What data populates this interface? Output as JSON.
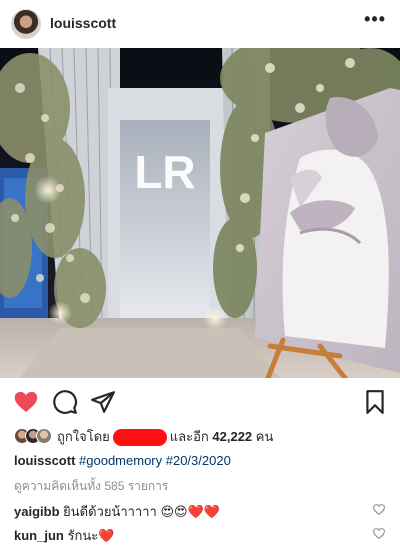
{
  "post": {
    "username": "louisscott",
    "more_label": "•••"
  },
  "likes": {
    "prefix": "ถูกใจโดย",
    "suffix": "และอีก",
    "count": "42,222",
    "unit": "คน"
  },
  "caption": {
    "username": "louisscott",
    "text": "#goodmemory  #20/3/2020"
  },
  "view_comments": "ดูความคิดเห็นทั้ง 585 รายการ",
  "comments": [
    {
      "username": "yaigibb",
      "text": "ยินดีด้วยน้าาาาา 😍😍❤️❤️"
    },
    {
      "username": "kun_jun",
      "text": "รักนะ❤️"
    }
  ],
  "icons": {
    "like": "heart-filled-icon",
    "comment": "comment-bubble-icon",
    "share": "paper-plane-icon",
    "save": "bookmark-icon"
  },
  "colors": {
    "like_red": "#ed4956",
    "hashtag_blue": "#00376b",
    "muted": "#8e8e8e"
  }
}
